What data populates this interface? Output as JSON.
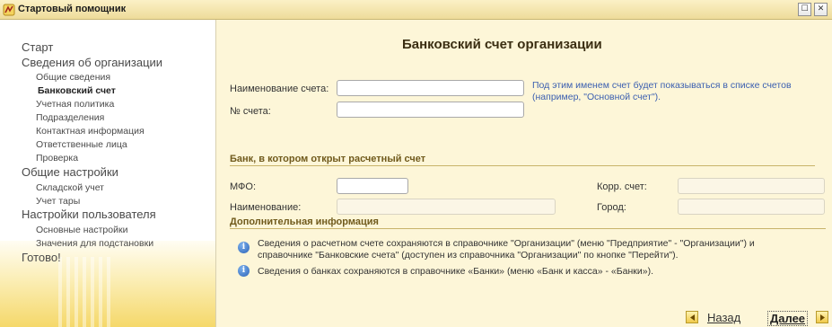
{
  "window": {
    "title": "Стартовый помощник",
    "restore_glyph": "☐",
    "close_glyph": "✕"
  },
  "sidebar": {
    "items": [
      {
        "label": "Старт",
        "level": 1
      },
      {
        "label": "Сведения об организации",
        "level": 1
      },
      {
        "label": "Общие сведения",
        "level": 2
      },
      {
        "label": "Банковский счет",
        "level": 2,
        "current": true
      },
      {
        "label": "Учетная политика",
        "level": 2
      },
      {
        "label": "Подразделения",
        "level": 2
      },
      {
        "label": "Контактная информация",
        "level": 2
      },
      {
        "label": "Ответственные лица",
        "level": 2
      },
      {
        "label": "Проверка",
        "level": 2
      },
      {
        "label": "Общие настройки",
        "level": 1
      },
      {
        "label": "Складской учет",
        "level": 2
      },
      {
        "label": "Учет тары",
        "level": 2
      },
      {
        "label": "Настройки пользователя",
        "level": 1
      },
      {
        "label": "Основные настройки",
        "level": 2
      },
      {
        "label": "Значения для подстановки",
        "level": 2
      },
      {
        "label": "Готово!",
        "level": 1
      }
    ]
  },
  "main": {
    "title": "Банковский счет организации",
    "account_name_label": "Наименование счета:",
    "account_name_value": "",
    "account_number_label": "№ счета:",
    "account_number_value": "",
    "hint_line1": "Под этим именем счет будет показываться в списке счетов",
    "hint_line2": "(например, \"Основной счет\").",
    "bank_section_title": "Банк, в котором открыт расчетный счет",
    "mfo_label": "МФО:",
    "mfo_value": "",
    "bank_name_label": "Наименование:",
    "bank_name_value": "",
    "corr_account_label": "Корр. счет:",
    "corr_account_value": "",
    "city_label": "Город:",
    "city_value": "",
    "extra_section_title": "Дополнительная информация",
    "info1_line1": "Сведения о расчетном счете сохраняются в справочнике \"Организации\" (меню \"Предприятие\" - \"Организации\") и",
    "info1_line2": "справочнике \"Банковские счета\" (доступен из справочника \"Организации\" по кнопке \"Перейти\").",
    "info2": "Сведения о банках сохраняются в справочнике «Банки» (меню «Банк и касса» - «Банки»).",
    "info_icon_glyph": "i"
  },
  "footer": {
    "back_label": "Назад",
    "next_label": "Далее"
  },
  "colors": {
    "background": "#fdf6d8",
    "accent": "#f0c94a",
    "hint": "#3b5fb0",
    "section": "#705a1c"
  },
  "icons": [
    "app-icon",
    "restore-icon",
    "close-icon",
    "info-icon",
    "arrow-left-icon",
    "arrow-right-icon"
  ]
}
